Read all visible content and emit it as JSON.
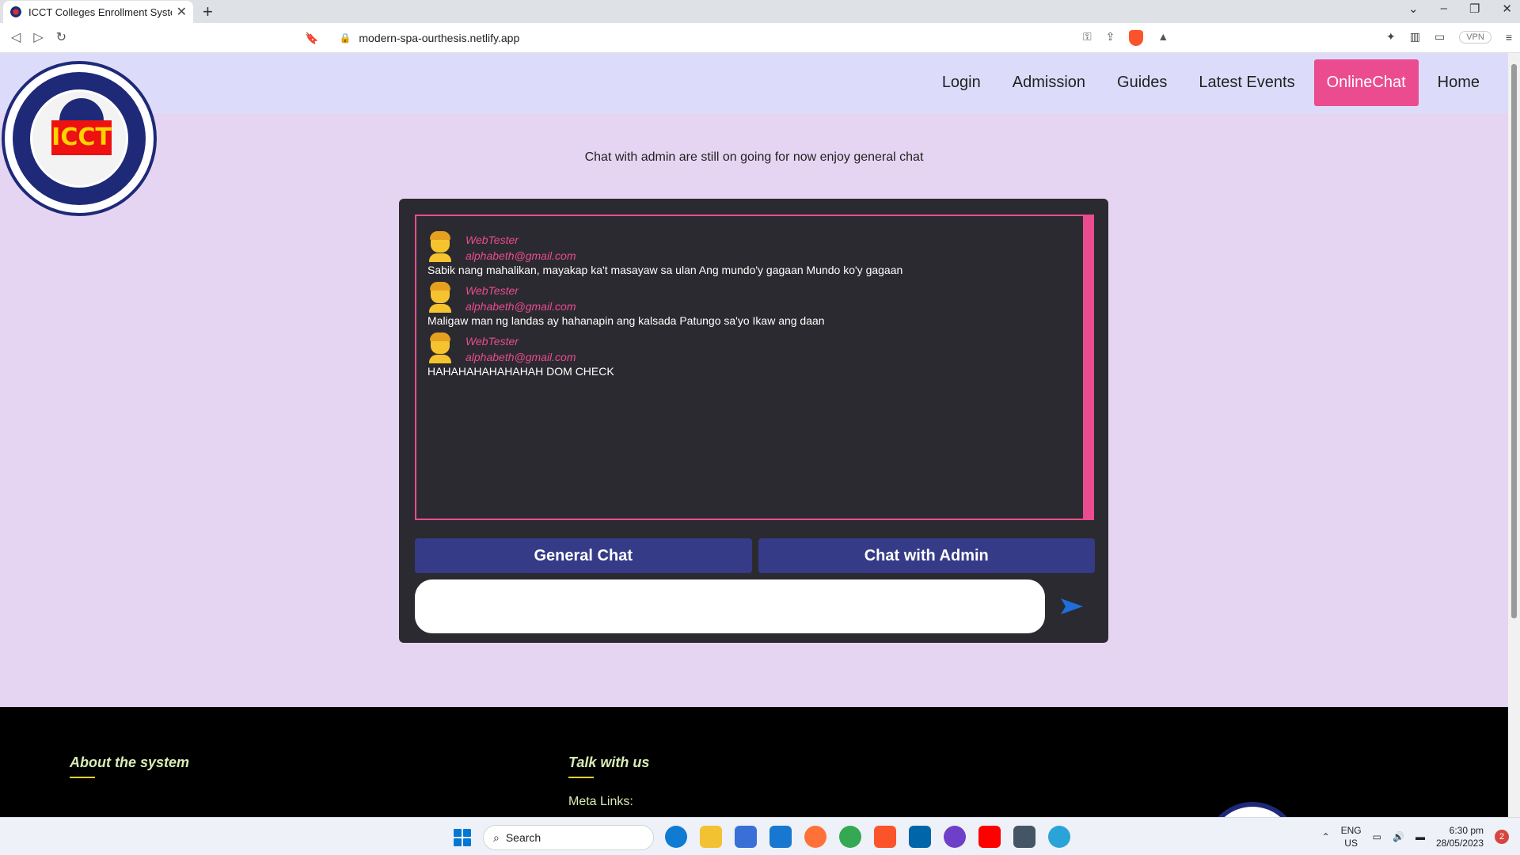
{
  "browser": {
    "tab_title": "ICCT Colleges Enrollment System",
    "url": "modern-spa-ourthesis.netlify.app",
    "vpn_label": "VPN"
  },
  "nav": {
    "items": [
      {
        "label": "Login"
      },
      {
        "label": "Admission"
      },
      {
        "label": "Guides"
      },
      {
        "label": "Latest Events"
      },
      {
        "label": "OnlineChat"
      },
      {
        "label": "Home"
      }
    ]
  },
  "logo": {
    "mark": "ICCT"
  },
  "notice": "Chat with admin are still on going for now enjoy general chat",
  "chat": {
    "messages": [
      {
        "name": "WebTester",
        "email": "alphabeth@gmail.com",
        "text": "Sabik nang mahalikan, mayakap ka't masayaw sa ulan Ang mundo'y gagaan Mundo ko'y gagaan"
      },
      {
        "name": "WebTester",
        "email": "alphabeth@gmail.com",
        "text": "Maligaw man ng landas ay hahanapin ang kalsada Patungo sa'yo Ikaw ang daan"
      },
      {
        "name": "WebTester",
        "email": "alphabeth@gmail.com",
        "text": "HAHAHAHAHAHAHAH DOM CHECK"
      }
    ],
    "general_chat_label": "General Chat",
    "admin_chat_label": "Chat with Admin",
    "input_value": ""
  },
  "footer": {
    "about_heading": "About the system",
    "talk_heading": "Talk with us",
    "meta_links_label": "Meta Links:"
  },
  "taskbar": {
    "search_label": "Search",
    "lang_top": "ENG",
    "lang_bottom": "US",
    "time": "6:30 pm",
    "date": "28/05/2023",
    "notification_count": "2"
  },
  "colors": {
    "accent_pink": "#ea4c8f",
    "button_indigo": "#353b87",
    "page_bg": "#e6d5f2",
    "header_bg": "#dcdcfa",
    "chat_bg": "#2b2a30"
  }
}
